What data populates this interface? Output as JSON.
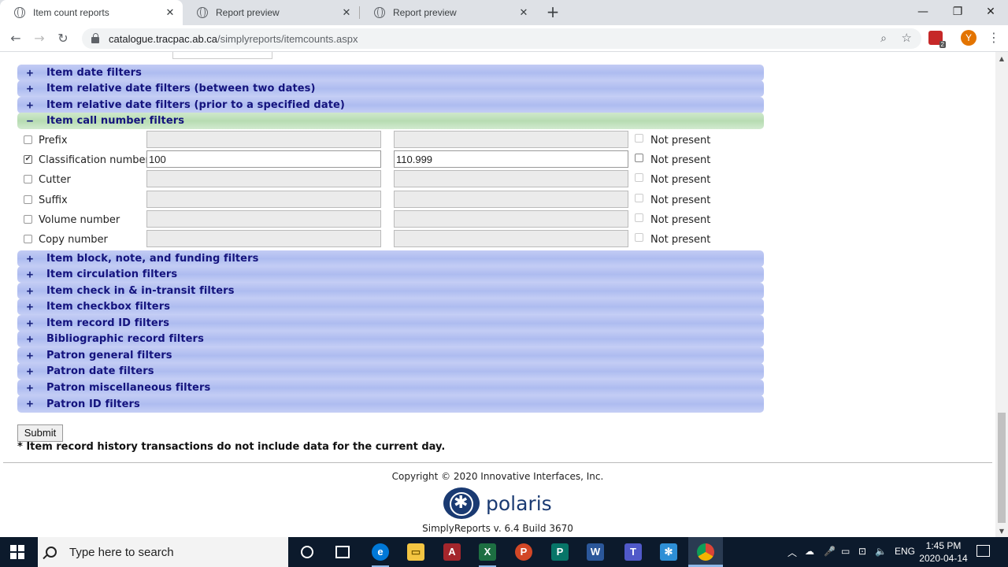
{
  "browser": {
    "tabs": [
      {
        "title": "Item count reports",
        "active": true
      },
      {
        "title": "Report preview",
        "active": false
      },
      {
        "title": "Report preview",
        "active": false
      }
    ],
    "url_host": "catalogue.tracpac.ab.ca",
    "url_path": "/simplyreports/itemcounts.aspx",
    "profile_initial": "Y",
    "extension_badge": "2"
  },
  "filters_top": [
    {
      "sign": "+",
      "label": "Item date filters"
    },
    {
      "sign": "+",
      "label": "Item relative date filters (between two dates)"
    },
    {
      "sign": "+",
      "label": "Item relative date filters (prior to a specified date)"
    },
    {
      "sign": "−",
      "label": "Item call number filters"
    }
  ],
  "call_number_rows": [
    {
      "label": "Prefix",
      "checked": false,
      "from": "",
      "to": "",
      "not_present": "Not present"
    },
    {
      "label": "Classification number",
      "checked": true,
      "from": "100",
      "to": "110.999",
      "not_present": "Not present"
    },
    {
      "label": "Cutter",
      "checked": false,
      "from": "",
      "to": "",
      "not_present": "Not present"
    },
    {
      "label": "Suffix",
      "checked": false,
      "from": "",
      "to": "",
      "not_present": "Not present"
    },
    {
      "label": "Volume number",
      "checked": false,
      "from": "",
      "to": "",
      "not_present": "Not present"
    },
    {
      "label": "Copy number",
      "checked": false,
      "from": "",
      "to": "",
      "not_present": "Not present"
    }
  ],
  "filters_bottom": [
    {
      "sign": "+",
      "label": "Item block, note, and funding filters"
    },
    {
      "sign": "+",
      "label": "Item circulation filters"
    },
    {
      "sign": "+",
      "label": "Item check in & in-transit filters"
    },
    {
      "sign": "+",
      "label": "Item checkbox filters"
    },
    {
      "sign": "+",
      "label": "Item record ID filters"
    },
    {
      "sign": "+",
      "label": "Bibliographic record filters"
    },
    {
      "sign": "+",
      "label": "Patron general filters"
    },
    {
      "sign": "+",
      "label": "Patron date filters"
    },
    {
      "sign": "+",
      "label": "Patron miscellaneous filters"
    },
    {
      "sign": "+",
      "label": "Patron ID filters"
    }
  ],
  "submit_label": "Submit",
  "note": "* Item record history transactions do not include data for the current day.",
  "footer": {
    "copyright": "Copyright © 2020 Innovative Interfaces, Inc.",
    "logo_text": "polaris",
    "version": "SimplyReports v. 6.4 Build 3670"
  },
  "taskbar": {
    "search_placeholder": "Type here to search",
    "language": "ENG",
    "time": "1:45 PM",
    "date": "2020-04-14"
  },
  "colors": {
    "collapsed_bar": "#aebcf0",
    "expanded_bar": "#b7dcb2",
    "label_text": "#14137d",
    "taskbar": "#0c1a2c"
  }
}
